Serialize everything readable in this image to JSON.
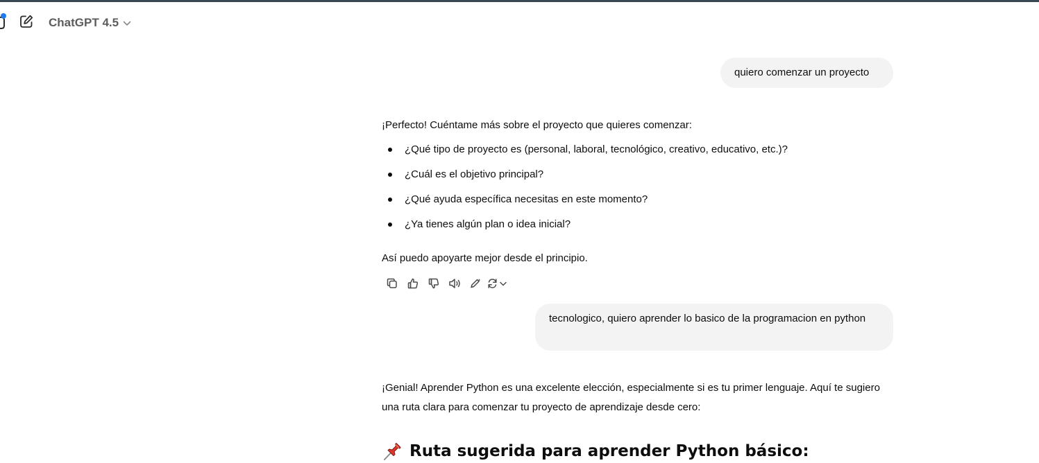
{
  "header": {
    "model_label": "ChatGPT 4.5"
  },
  "conversation": {
    "user_messages": [
      "quiero comenzar un proyecto",
      "tecnologico, quiero aprender lo basico de la programacion en python"
    ],
    "assistant_1": {
      "intro": "¡Perfecto! Cuéntame más sobre el proyecto que quieres comenzar:",
      "questions": [
        "¿Qué tipo de proyecto es (personal, laboral, tecnológico, creativo, educativo, etc.)?",
        "¿Cuál es el objetivo principal?",
        "¿Qué ayuda específica necesitas en este momento?",
        "¿Ya tienes algún plan o idea inicial?"
      ],
      "outro": "Así puedo apoyarte mejor desde el principio."
    },
    "assistant_2": {
      "text": "¡Genial! Aprender Python es una excelente elección, especialmente si es tu primer lenguaje. Aquí te sugiero una ruta clara para comenzar tu proyecto de aprendizaje desde cero:",
      "heading": "Ruta sugerida para aprender Python básico:",
      "heading_icon": "pushpin-icon"
    }
  },
  "message_actions": [
    "copy-icon",
    "thumbs-up-icon",
    "thumbs-down-icon",
    "read-aloud-icon",
    "edit-icon",
    "regenerate-icon"
  ],
  "colors": {
    "accent_dot": "#1f7aec",
    "user_bubble": "#f3f3f3",
    "top_bar": "#3a4750"
  }
}
